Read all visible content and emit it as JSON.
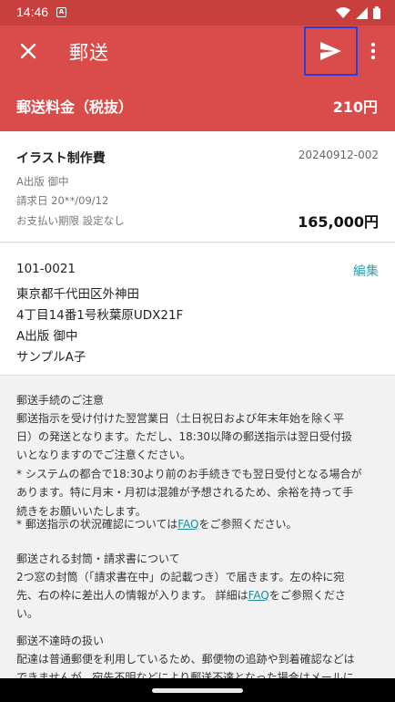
{
  "status_bar": {
    "time": "14:46",
    "notification_badge": "A",
    "icons": [
      "wifi-icon",
      "signal-icon",
      "battery-icon"
    ]
  },
  "app_bar": {
    "title": "郵送",
    "close_icon": "close-icon",
    "send_icon": "send-icon",
    "more_icon": "more-vert-icon"
  },
  "fee": {
    "label": "郵送料金（税抜）",
    "value": "210円"
  },
  "invoice": {
    "name": "イラスト制作費",
    "number": "20240912-002",
    "client": "A出版 御中",
    "issue_date": "請求日 20**/09/12",
    "due": "お支払い期限 設定なし",
    "amount": "165,000円"
  },
  "address": {
    "lines": [
      "101-0021",
      "東京都千代田区外神田",
      "4丁目14番1号秋葉原UDX21F",
      "A出版 御中",
      "サンプルA子"
    ],
    "edit_label": "編集"
  },
  "notes": {
    "p1": [
      "郵送手続のご注意",
      "郵送指示を受け付けた翌営業日（土日祝日および年末年始を除く平",
      "日）の発送となります。ただし、18:30以降の郵送指示は翌日受付扱",
      "いとなりますのでご注意ください。",
      "* システムの都合で18:30より前のお手続きでも翌日受付となる場合が",
      "あります。特に月末・月初は混雑が予想されるため、余裕を持って手",
      "続きをお願いいたします。"
    ],
    "p1_last_before": "* 郵送指示の状況確認については",
    "p1_last_link": "FAQ",
    "p1_last_after": "をご参照ください。",
    "p2": [
      "郵送される封筒・請求書について",
      "2つ窓の封筒（「請求書在中」の記載つき）で届きます。左の枠に宛"
    ],
    "p2_last_before": "先、右の枠に差出人の情報が入ります。 詳細は",
    "p2_last_link": "FAQ",
    "p2_last_after": "をご参照くださ",
    "p2_tail": "い。",
    "p3": [
      "郵送不達時の扱い",
      "配達は普通郵便を利用しているため、郵便物の追跡や到着確認などは",
      "できませんが、宛先不明などにより郵送不達となった場合はメールに"
    ]
  }
}
